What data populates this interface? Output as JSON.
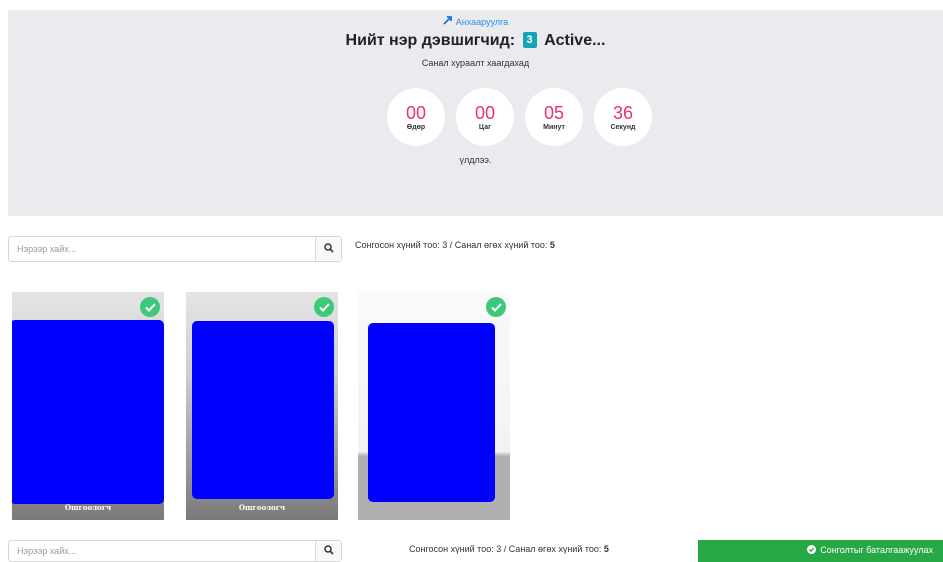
{
  "header": {
    "notice": "Анхааруулга",
    "title_prefix": "Нийт нэр дэвшигчид:",
    "candidate_count": "3",
    "title_suffix": "Active...",
    "subtitle": "Санал хураалт хаагдахад",
    "ended_text": "үлдлээ."
  },
  "countdown": [
    {
      "value": "00",
      "label": "Өдөр"
    },
    {
      "value": "00",
      "label": "Цаг"
    },
    {
      "value": "05",
      "label": "Минут"
    },
    {
      "value": "36",
      "label": "Секунд"
    }
  ],
  "search": {
    "placeholder": "Нэрээр хайх..."
  },
  "selection": {
    "prefix": "Сонгосон хүний тоо: 3 / Санал өгөх хүний тоо:",
    "max": "5"
  },
  "candidates": [
    {
      "caption": "Ошгоологч",
      "selected": true
    },
    {
      "caption": "Ошгоологч",
      "selected": true
    },
    {
      "caption": "",
      "selected": true
    }
  ],
  "confirm": {
    "label": "Сонголтыг баталгаажуулах"
  },
  "colors": {
    "accent_pink": "#e8336b",
    "badge_teal": "#17a2b8",
    "check_green": "#3ec97a",
    "confirm_green": "#28a745",
    "hero_bg": "#e9ebee"
  }
}
